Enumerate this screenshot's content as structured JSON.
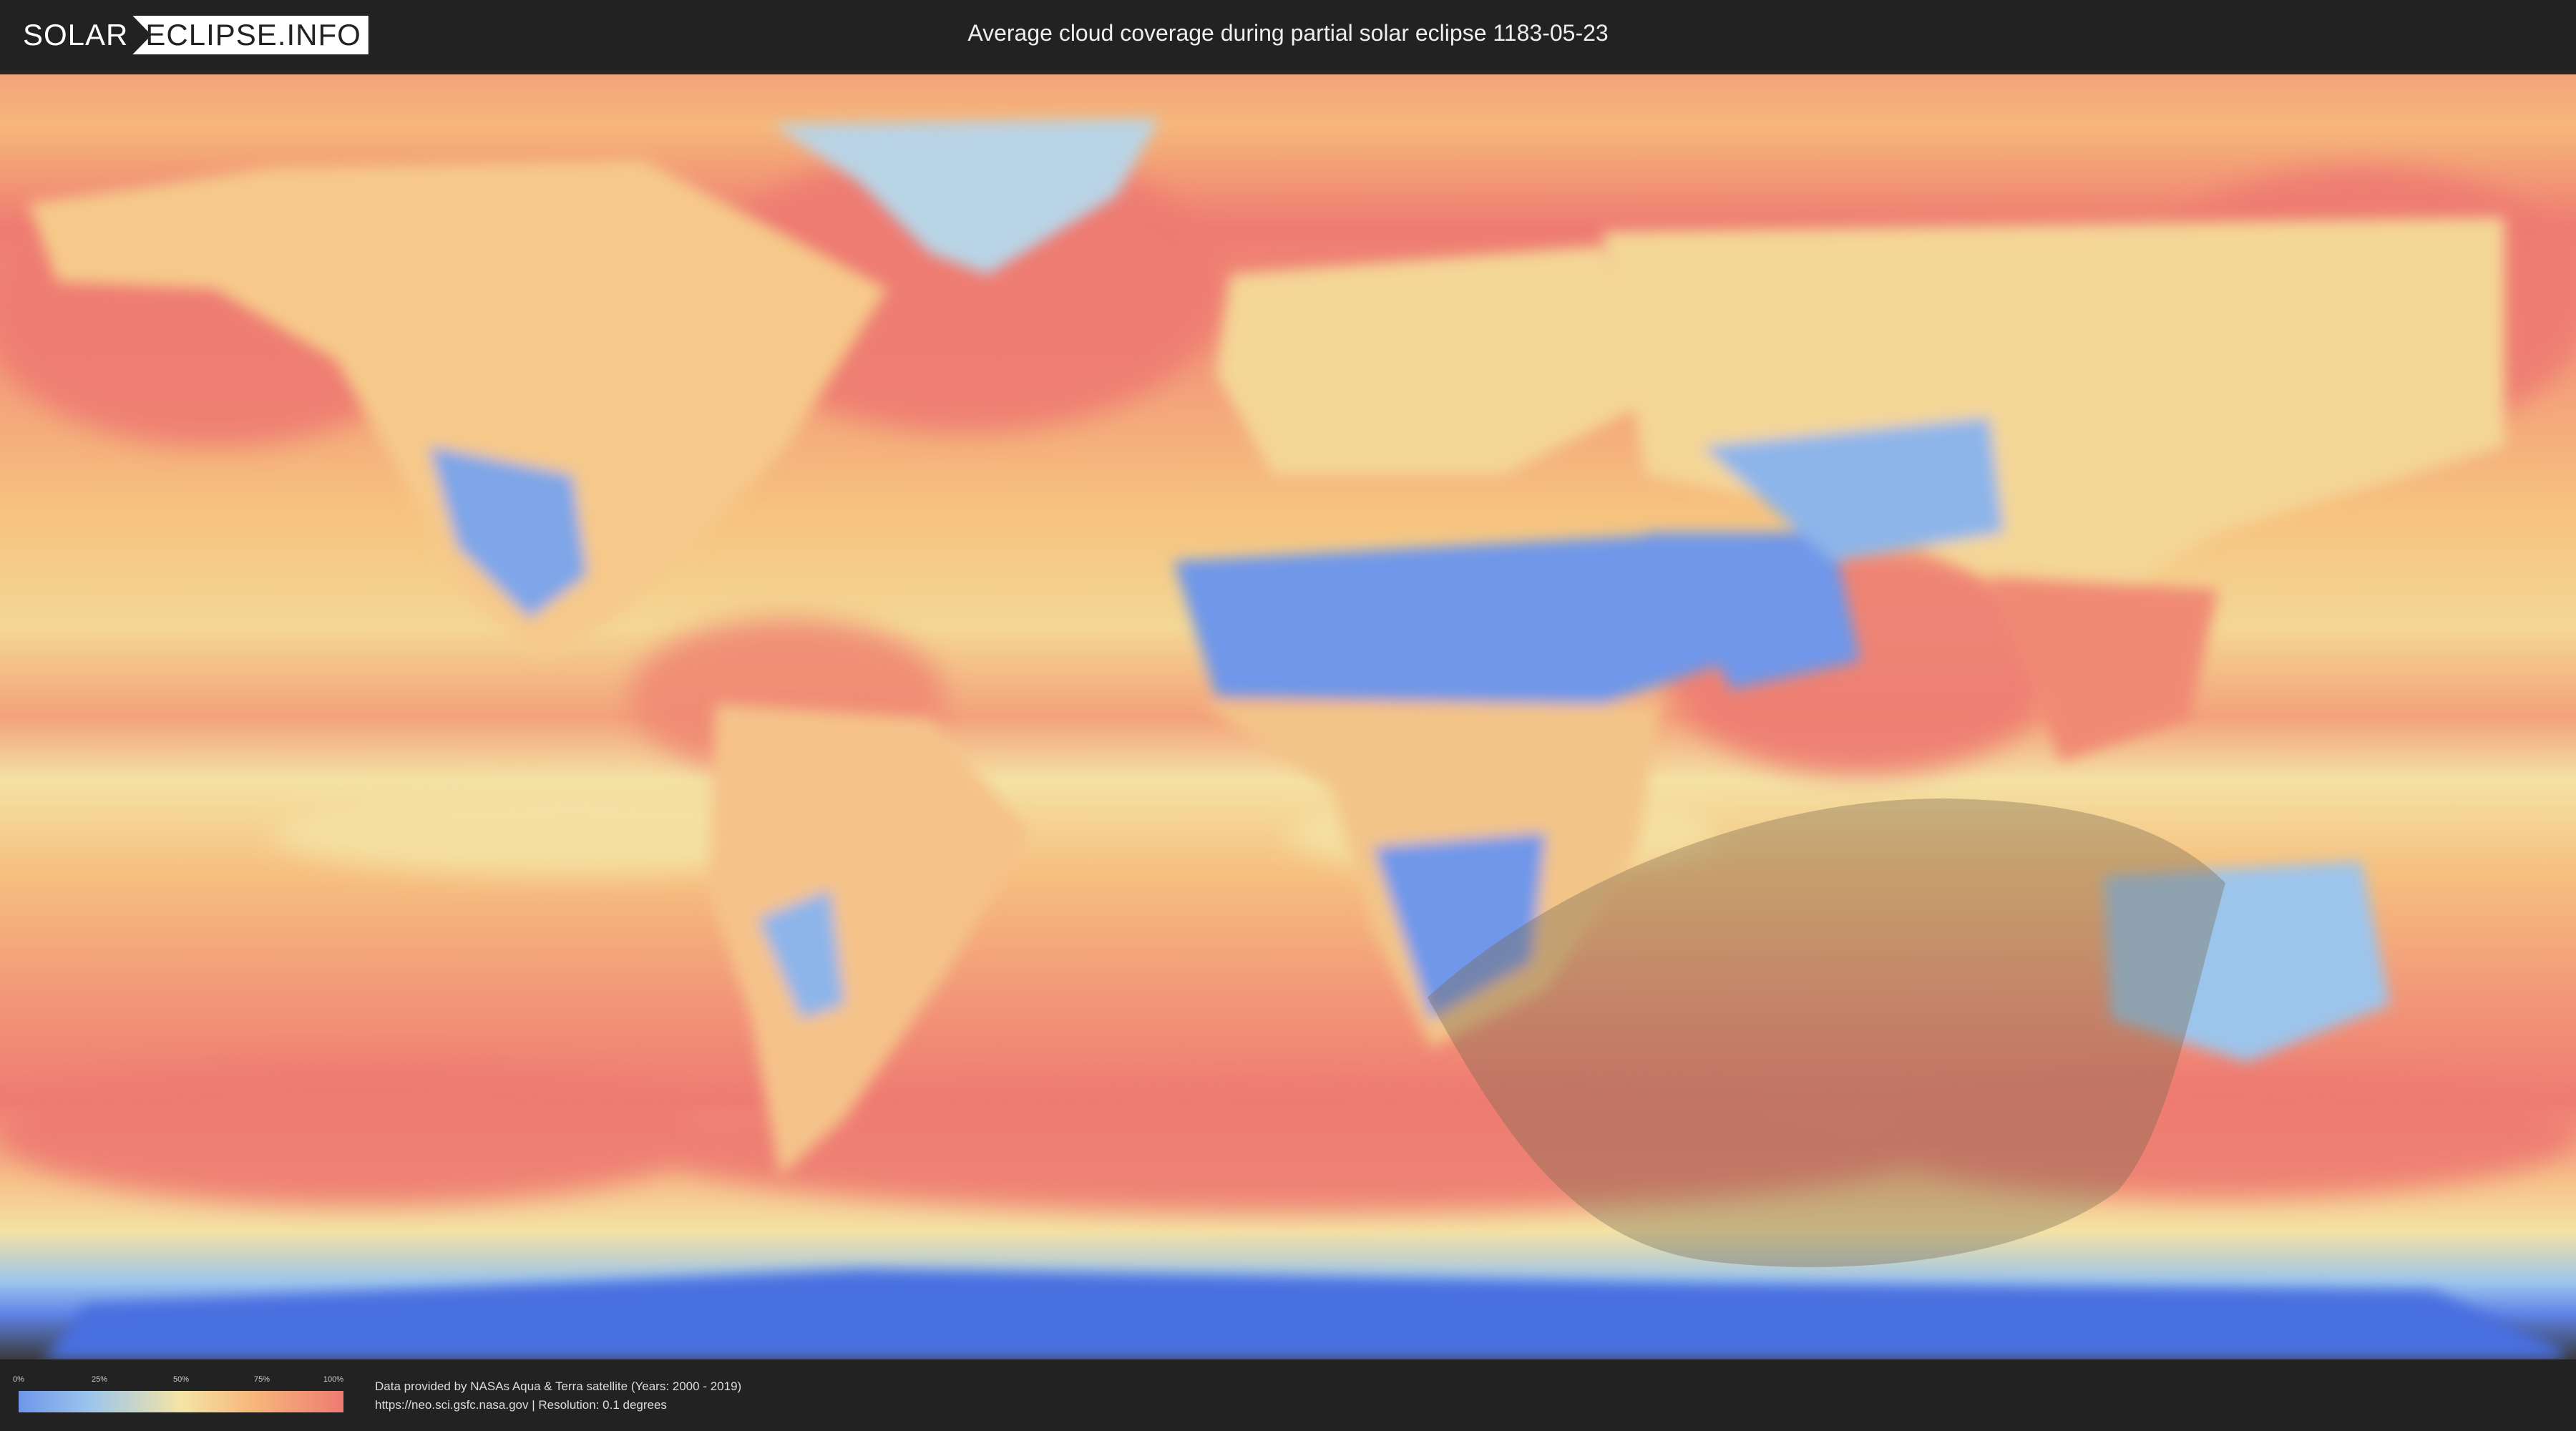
{
  "header": {
    "logo_solar": "SOLAR",
    "logo_rest": "ECLIPSE.INFO",
    "title": "Average cloud coverage during partial solar eclipse 1183-05-23"
  },
  "legend": {
    "ticks": [
      "0%",
      "25%",
      "50%",
      "75%",
      "100%"
    ],
    "tick_fractions": [
      0,
      0.25,
      0.5,
      0.75,
      1.0
    ],
    "gradient_colors": [
      "#6f97e9",
      "#9cc5ec",
      "#f4e4a6",
      "#f6b77a",
      "#ee7b72"
    ]
  },
  "footer": {
    "credit_line_1": "Data provided by NASAs Aqua & Terra satellite (Years: 2000 - 2019)",
    "credit_line_2": "https://neo.sci.gsfc.nasa.gov | Resolution: 0.1 degrees"
  },
  "map": {
    "projection": "equirectangular",
    "layer": "average cloud coverage",
    "colors": {
      "ocean_high_cloud": "#ee7b72",
      "mid_cloud": "#f6b77a",
      "low_mid_cloud": "#f4e4a6",
      "low_cloud": "#9cc5ec",
      "clear": "#6f97e9",
      "antarctic_band": "#4a6fe0",
      "eclipse_overlay": "#7a6a50"
    }
  }
}
